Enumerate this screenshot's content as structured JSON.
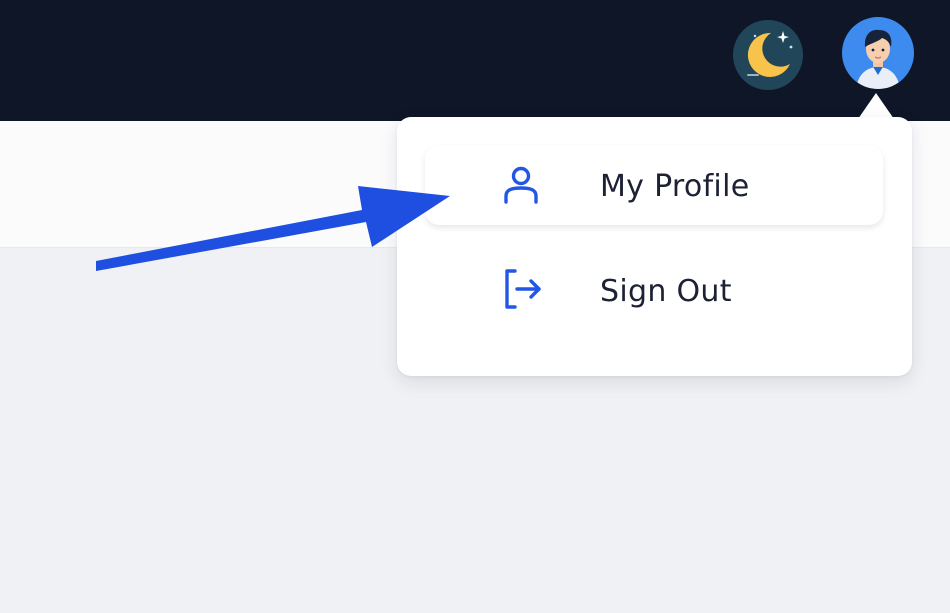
{
  "header": {
    "theme_toggle": {
      "icon": "moon-icon",
      "colors": {
        "background": "#21465a",
        "moon": "#f7c34a"
      }
    },
    "user_avatar": {
      "icon": "user-avatar-icon",
      "colors": {
        "background": "#3e8bf0"
      }
    }
  },
  "user_menu": {
    "items": [
      {
        "label": "My Profile",
        "icon": "user-icon"
      },
      {
        "label": "Sign Out",
        "icon": "sign-out-icon"
      }
    ]
  },
  "colors": {
    "topbar": "#0e1628",
    "accent": "#2257e6",
    "annotation_arrow": "#1f4fe0",
    "text": "#1c2133"
  }
}
